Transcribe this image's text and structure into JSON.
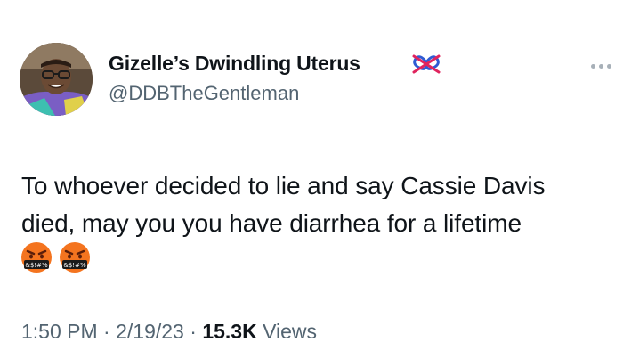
{
  "author": {
    "display_name": "Gizelle’s Dwindling Uterus",
    "name_emoji": "no-pretzel-emoji",
    "handle": "@DDBTheGentleman",
    "avatar": "avatar-photo"
  },
  "tweet": {
    "text_line_1": "To whoever decided to lie and say Cassie Davis",
    "text_line_2": "died, may you you have diarrhea for a lifetime",
    "emojis": [
      "face-with-symbols-on-mouth",
      "face-with-symbols-on-mouth"
    ],
    "emoji_symbol_text": "&$!#%"
  },
  "meta": {
    "time": "1:50 PM",
    "separator": "·",
    "date": "2/19/23",
    "views_count": "15.3K",
    "views_label": "Views"
  },
  "icons": {
    "more": "more-horizontal-icon"
  },
  "colors": {
    "text_primary": "#0f1419",
    "text_secondary": "#536471",
    "background": "#ffffff"
  }
}
